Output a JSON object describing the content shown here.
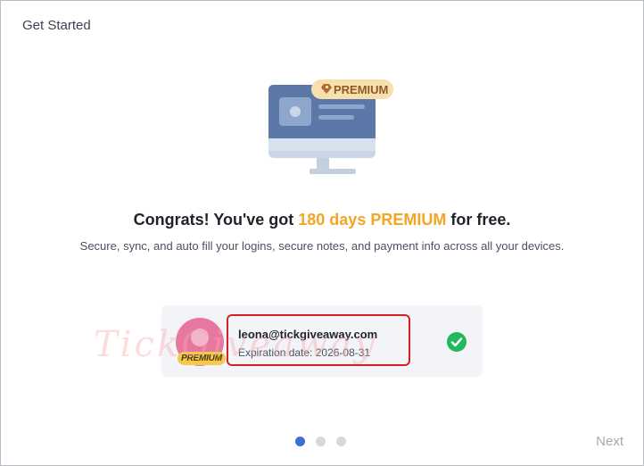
{
  "window": {
    "title": "Get Started"
  },
  "hero": {
    "badge_label": "PREMIUM",
    "icon": "monitor-illustration"
  },
  "headline": {
    "before": "Congrats! You've got ",
    "highlight": "180 days PREMIUM",
    "after": " for free."
  },
  "subline": "Secure, sync, and auto fill your logins, secure notes, and payment info across all your devices.",
  "account": {
    "email": "leona@tickgiveaway.com",
    "expiration": "Expiration date: 2026-08-31",
    "premium_chip": "PREMIUM",
    "status_icon": "check-circle-icon"
  },
  "watermark": "TickGiveaway",
  "pagination": {
    "total": 3,
    "current": 1
  },
  "footer": {
    "next_label": "Next"
  },
  "colors": {
    "accent": "#f5a524",
    "primary": "#3b6fd6",
    "success": "#22b85b",
    "highlight_border": "#d61f26"
  }
}
